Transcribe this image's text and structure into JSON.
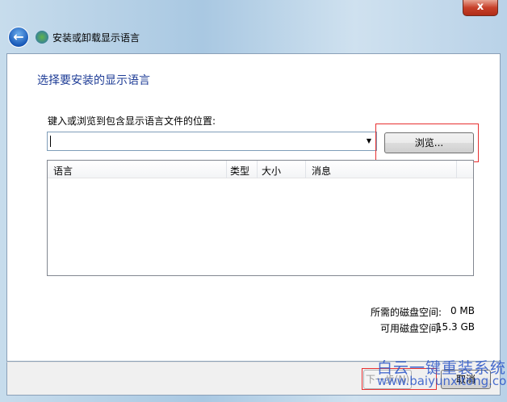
{
  "window": {
    "title": "安装或卸载显示语言",
    "close_label": "x"
  },
  "main": {
    "heading": "选择要安装的显示语言",
    "location_label": "键入或浏览到包含显示语言文件的位置:",
    "location_value": "",
    "browse_label": "浏览...",
    "table": {
      "columns": [
        "语言",
        "类型",
        "大小",
        "消息"
      ],
      "rows": []
    },
    "disk": {
      "required_label": "所需的磁盘空间:",
      "required_value": "0 MB",
      "available_label": "可用磁盘空间:",
      "available_value": "15.3 GB"
    }
  },
  "footer": {
    "next_label": "下一步(N)",
    "cancel_label": "取消"
  },
  "watermark": {
    "line1": "白云一键重装系统",
    "line2": "www.baiyunxitong.com"
  }
}
